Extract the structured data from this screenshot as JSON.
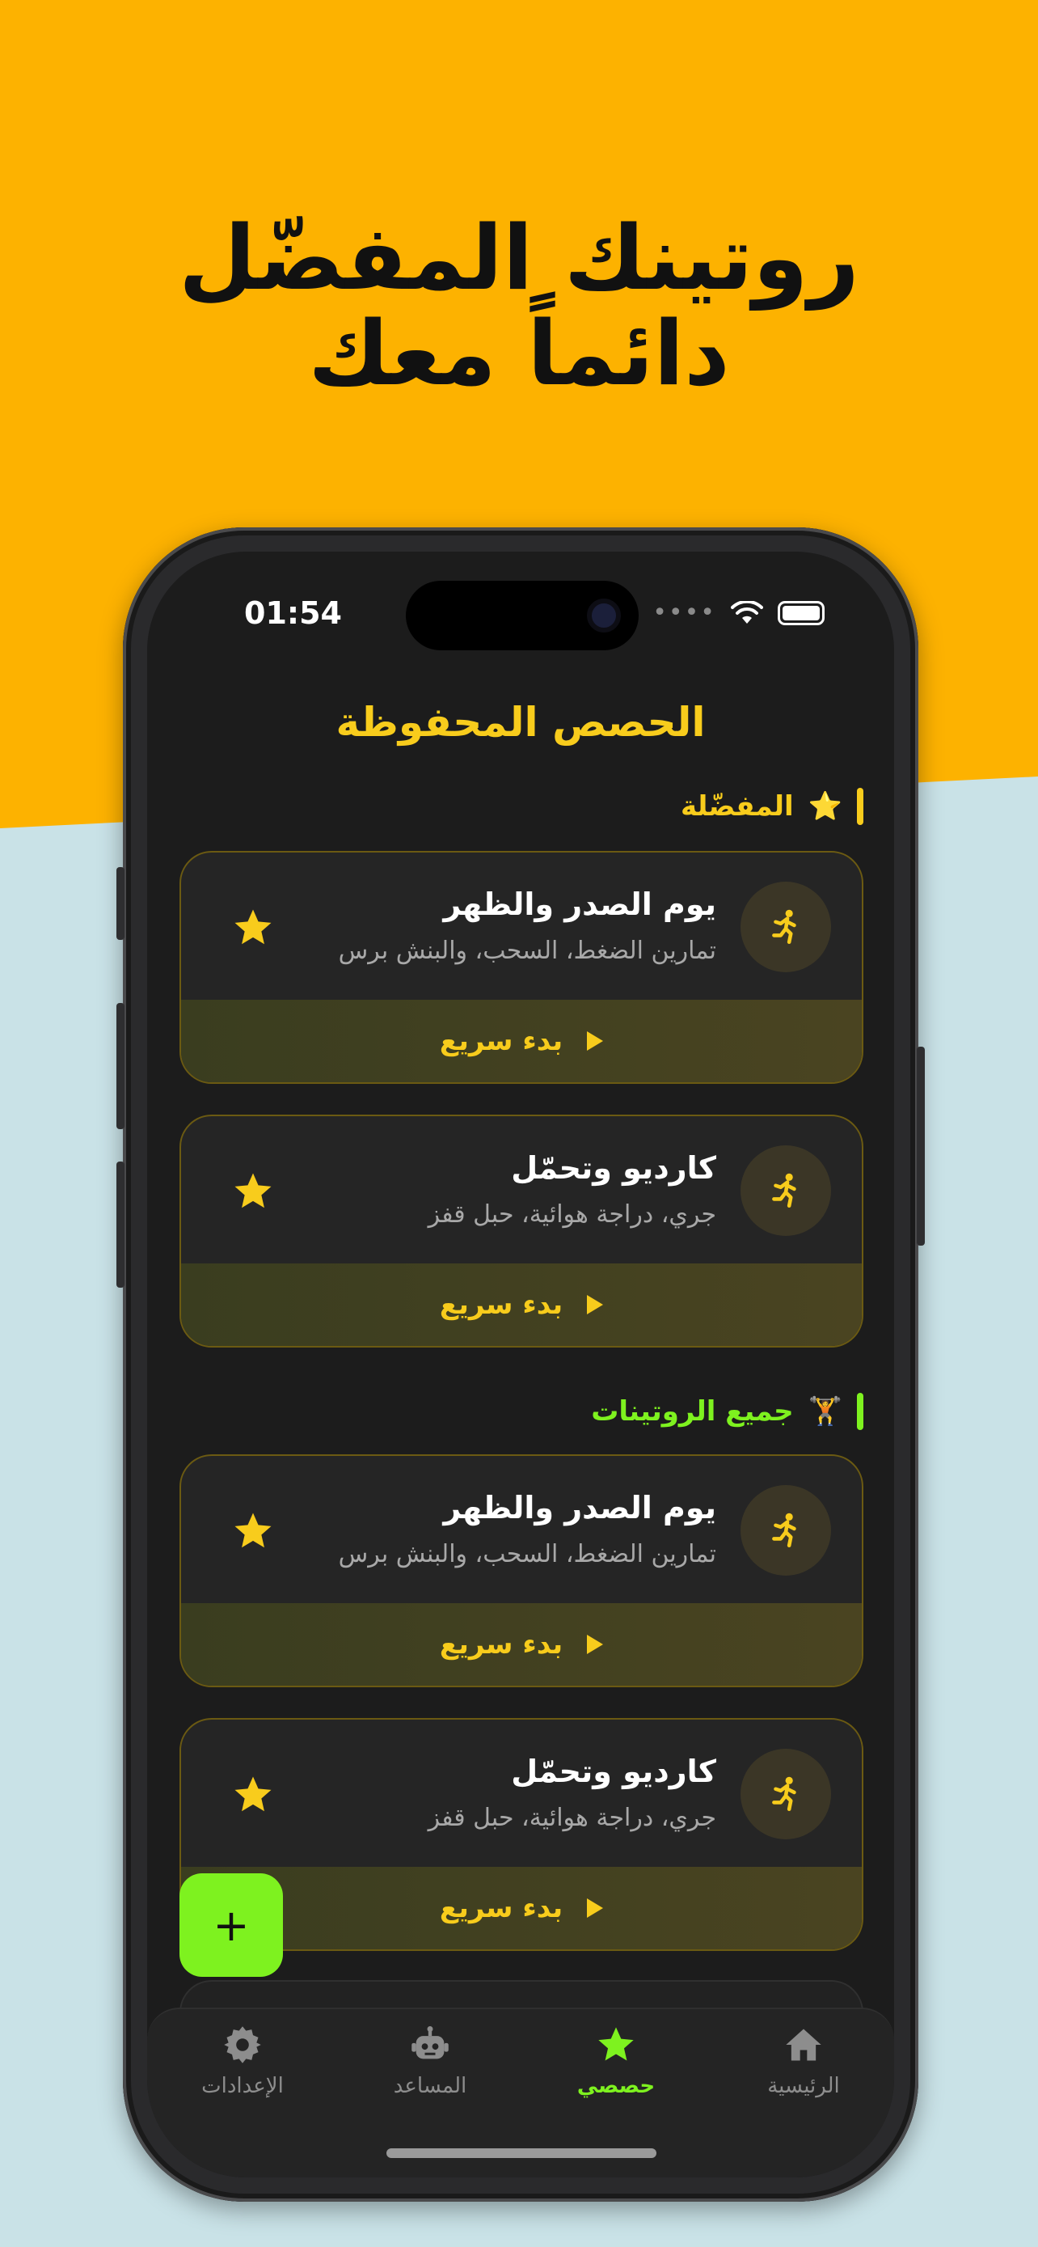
{
  "headline": {
    "line1": "روتينك المفضّل",
    "line2": "دائماً معك"
  },
  "status_bar": {
    "time": "01:54"
  },
  "screen": {
    "title": "الحصص المحفوظة"
  },
  "sections": {
    "favorites": {
      "label": "المفضّلة",
      "emoji": "⭐",
      "color": "#f8cc1c"
    },
    "all": {
      "label": "جميع الروتينات",
      "emoji": "🏋️",
      "color": "#7ef21f"
    }
  },
  "cards": [
    {
      "title": "يوم الصدر والظهر",
      "subtitle": "تمارين الضغط، السحب، والبنش برس",
      "action": "بدء سريع"
    },
    {
      "title": "كارديو وتحمّل",
      "subtitle": "جري، دراجة هوائية، حبل قفز",
      "action": "بدء سريع"
    },
    {
      "title": "يوم الصدر والظهر",
      "subtitle": "تمارين الضغط، السحب، والبنش برس",
      "action": "بدء سريع"
    },
    {
      "title": "كارديو وتحمّل",
      "subtitle": "جري، دراجة هوائية، حبل قفز",
      "action": "بدء سريع"
    }
  ],
  "fab": {
    "symbol": "+"
  },
  "tabs": [
    {
      "label": "الرئيسية",
      "icon": "home-icon"
    },
    {
      "label": "حصصي",
      "icon": "star-icon",
      "active": true
    },
    {
      "label": "المساعد",
      "icon": "robot-icon"
    },
    {
      "label": "الإعدادات",
      "icon": "gear-icon"
    }
  ],
  "colors": {
    "accent_yellow": "#f8cc1c",
    "accent_green": "#7ef21f",
    "hero_bg": "#fdb200"
  }
}
